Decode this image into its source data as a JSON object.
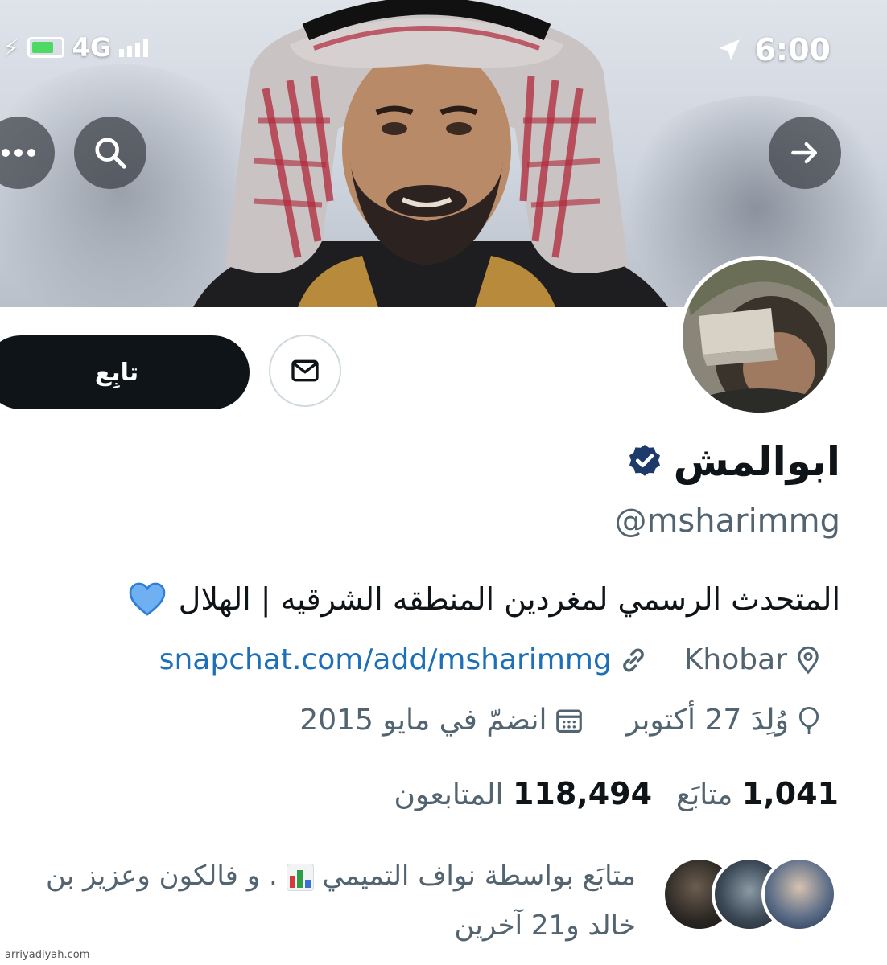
{
  "status_bar": {
    "network": "4G",
    "time": "6:00"
  },
  "header": {
    "back_icon": "arrow-right-icon",
    "search_icon": "search-icon",
    "more_icon": "more-dots-icon"
  },
  "actions": {
    "follow_label": "تابِع",
    "message_icon": "envelope-icon"
  },
  "profile": {
    "display_name": "ابوالمش",
    "verified": true,
    "handle": "@msharimmg",
    "bio": "المتحدث الرسمي لمغردين المنطقه الشرقيه | الهلال",
    "bio_emoji": "💙",
    "location": "Khobar",
    "website": "snapchat.com/add/msharimmg",
    "birthday": "وُلِدَ 27 أكتوبر",
    "joined": "انضمّ في مايو 2015"
  },
  "stats": {
    "following_count": "1,041",
    "following_label": "متابَع",
    "followers_count": "118,494",
    "followers_label": "المتابعون"
  },
  "followed_by": {
    "text_before": "متابَع بواسطة نواف التميمي",
    "text_after": ". و فالكون وعزيز بن خالد و21 آخرين"
  },
  "watermark": "arriyadiyah.com",
  "colors": {
    "link": "#1d6fb8",
    "verified": "#1d3a6b",
    "button_dark": "#0f1419",
    "muted": "#536471"
  }
}
